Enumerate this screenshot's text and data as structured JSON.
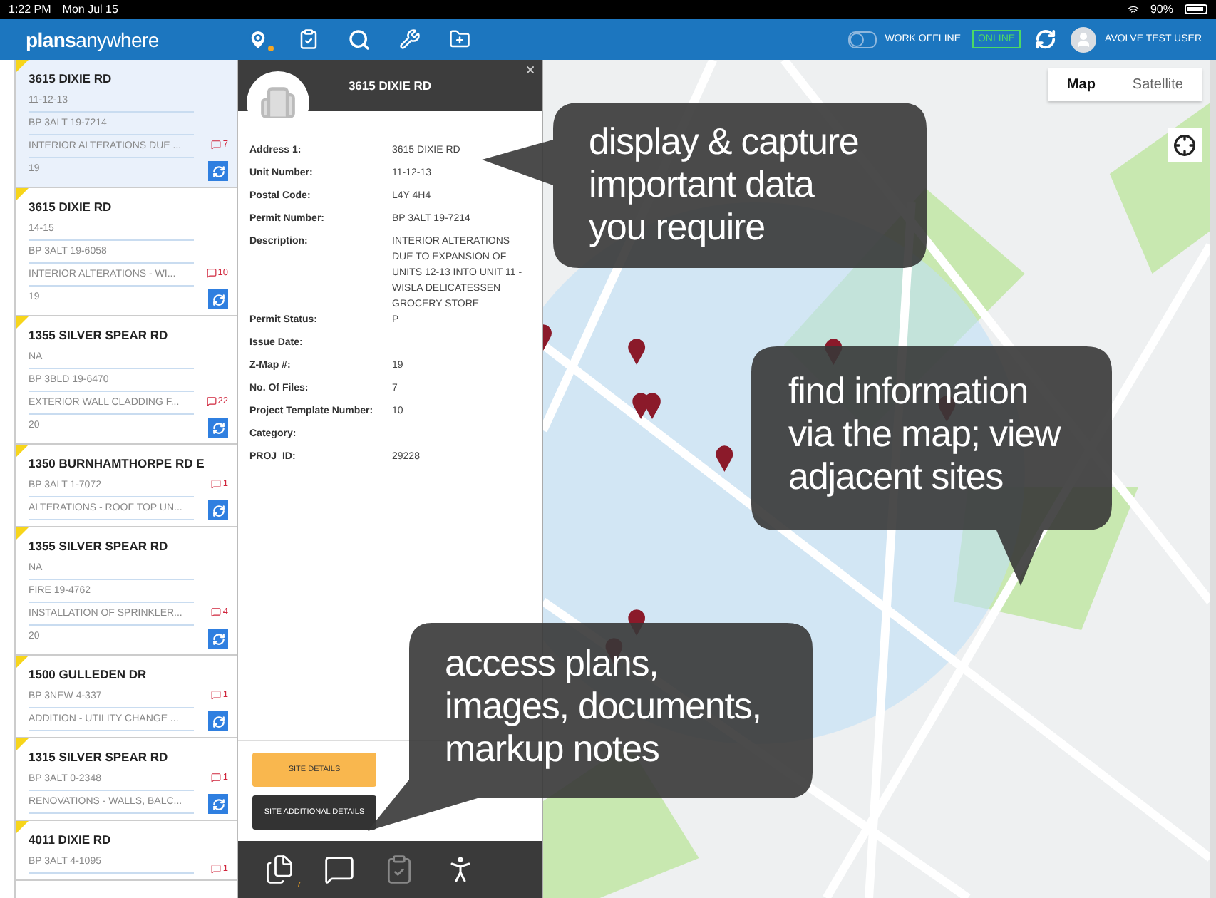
{
  "status_bar": {
    "time": "1:22 PM",
    "date": "Mon Jul 15",
    "battery": "90%"
  },
  "nav": {
    "logo": "**plans**anywhere",
    "offline_toggle": {
      "label": "WORK OFFLINE",
      "on": false
    },
    "connection": "ONLINE",
    "user": "AVOLVE TEST USER"
  },
  "sites": [
    {
      "title": "3615 DIXIE RD",
      "lines": [
        "11-12-13",
        "BP 3ALT 19-7214",
        "INTERIOR ALTERATIONS DUE ...",
        "19"
      ],
      "comments": "7",
      "selected": true
    },
    {
      "title": "3615 DIXIE RD",
      "lines": [
        "14-15",
        "BP 3ALT 19-6058",
        "INTERIOR ALTERATIONS - WI...",
        "19"
      ],
      "comments": "10",
      "selected": false
    },
    {
      "title": "1355 SILVER SPEAR RD",
      "lines": [
        "NA",
        "BP 3BLD 19-6470",
        "EXTERIOR WALL CLADDING F...",
        "20"
      ],
      "comments": "22",
      "selected": false
    },
    {
      "title": "1350 BURNHAMTHORPE RD E",
      "lines": [
        "BP 3ALT 1-7072",
        "ALTERATIONS - ROOF TOP UN..."
      ],
      "comments": "1",
      "selected": false
    },
    {
      "title": "1355 SILVER SPEAR RD",
      "lines": [
        "NA",
        "FIRE 19-4762",
        "INSTALLATION OF SPRINKLER...",
        "20"
      ],
      "comments": "4",
      "selected": false
    },
    {
      "title": "1500 GULLEDEN DR",
      "lines": [
        "BP 3NEW 4-337",
        "ADDITION - UTILITY CHANGE ..."
      ],
      "comments": "1",
      "selected": false
    },
    {
      "title": "1315 SILVER SPEAR RD",
      "lines": [
        "BP 3ALT 0-2348",
        "RENOVATIONS - WALLS, BALC..."
      ],
      "comments": "1",
      "selected": false
    },
    {
      "title": "4011 DIXIE RD",
      "lines": [
        "BP 3ALT 4-1095"
      ],
      "comments": "1",
      "selected": false
    }
  ],
  "detail": {
    "title": "3615 DIXIE RD",
    "fields": [
      {
        "label": "Address 1:",
        "value": "3615 DIXIE RD"
      },
      {
        "label": "Unit Number:",
        "value": "11-12-13"
      },
      {
        "label": "Postal Code:",
        "value": "L4Y 4H4"
      },
      {
        "label": "Permit Number:",
        "value": "BP 3ALT 19-7214"
      },
      {
        "label": "Description:",
        "value": "INTERIOR ALTERATIONS DUE TO EXPANSION OF UNITS 12-13 INTO UNIT 11 - WISLA DELICATESSEN GROCERY STORE"
      },
      {
        "label": "Permit Status:",
        "value": "P"
      },
      {
        "label": "Issue Date:"
      },
      {
        "label": "Z-Map #:",
        "value": "19"
      },
      {
        "label": "No. Of Files:",
        "value": "7"
      },
      {
        "label": "Project Template Number:",
        "value": "10"
      },
      {
        "label": "Category:"
      },
      {
        "label": "PROJ_ID:",
        "value": "29228"
      }
    ],
    "buttons": [
      {
        "label": "SITE DETAILS",
        "kind": "primary"
      },
      {
        "label": "SITE ADDITIONAL DETAILS",
        "kind": "dark"
      }
    ],
    "files_count": "7"
  },
  "map": {
    "types": [
      {
        "label": "Map",
        "selected": true
      },
      {
        "label": "Satellite",
        "selected": false
      }
    ]
  },
  "callouts": [
    {
      "text": "display & capture\nimportant data\nyou require"
    },
    {
      "text": "find information\nvia the map; view\nadjacent sites"
    },
    {
      "text": "access plans,\nimages, documents,\nmarkup notes"
    }
  ]
}
